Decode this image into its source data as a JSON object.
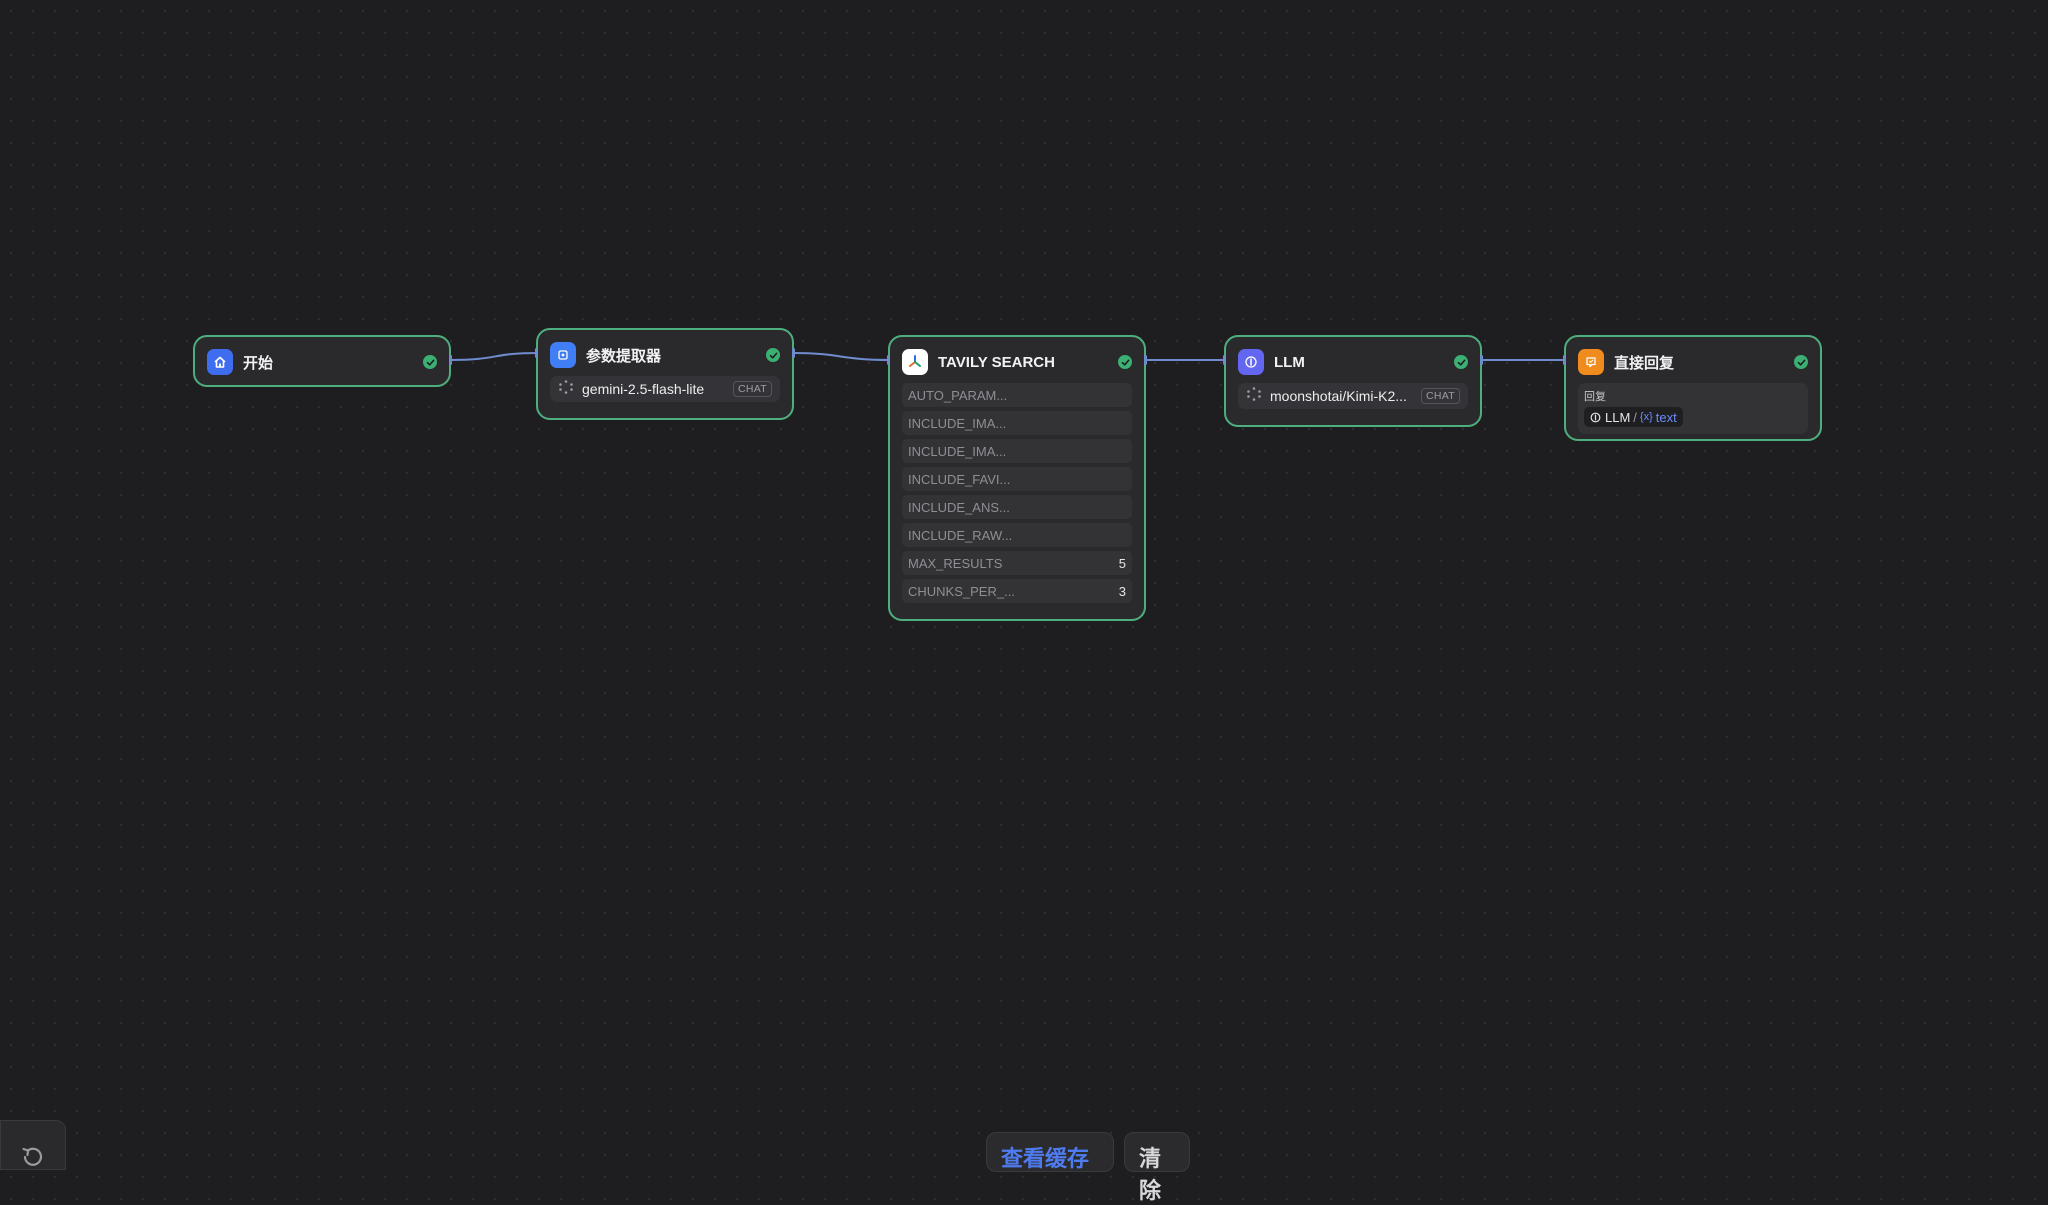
{
  "canvas": {
    "nodes": {
      "start": {
        "title": "开始",
        "icon": "home-icon",
        "status": "success"
      },
      "param_extractor": {
        "title": "参数提取器",
        "icon": "extractor-icon",
        "status": "success",
        "model": "gemini-2.5-flash-lite",
        "model_tag": "CHAT",
        "model_icon": "model-icon"
      },
      "tavily": {
        "title": "TAVILY SEARCH",
        "icon": "tavily-logo-icon",
        "status": "success",
        "params": [
          {
            "name": "AUTO_PARAM...",
            "value": ""
          },
          {
            "name": "INCLUDE_IMA...",
            "value": ""
          },
          {
            "name": "INCLUDE_IMA...",
            "value": ""
          },
          {
            "name": "INCLUDE_FAVI...",
            "value": ""
          },
          {
            "name": "INCLUDE_ANS...",
            "value": ""
          },
          {
            "name": "INCLUDE_RAW...",
            "value": ""
          },
          {
            "name": "MAX_RESULTS",
            "value": "5"
          },
          {
            "name": "CHUNKS_PER_...",
            "value": "3"
          }
        ]
      },
      "llm": {
        "title": "LLM",
        "icon": "llm-icon",
        "status": "success",
        "model": "moonshotai/Kimi-K2...",
        "model_tag": "CHAT",
        "model_icon": "model-icon"
      },
      "answer": {
        "title": "直接回复",
        "icon": "answer-icon",
        "status": "success",
        "field_label": "回复",
        "variable": {
          "node": "LLM",
          "separator": "/",
          "var_prefix": "{x}",
          "var_name": "text"
        }
      }
    }
  },
  "bottom_bar": {
    "primary_label": "查看缓存",
    "secondary_label": "清除"
  },
  "colors": {
    "node_border": "#4fae7e",
    "status_success": "#3bb072",
    "edge": "#6f8ccf",
    "start_icon_bg": "#3f6df0",
    "extractor_icon_bg": "#3f7ef5",
    "llm_icon_bg": "#6366f1",
    "answer_icon_bg": "#f08c1e",
    "primary_text": "#4f7bf0"
  }
}
